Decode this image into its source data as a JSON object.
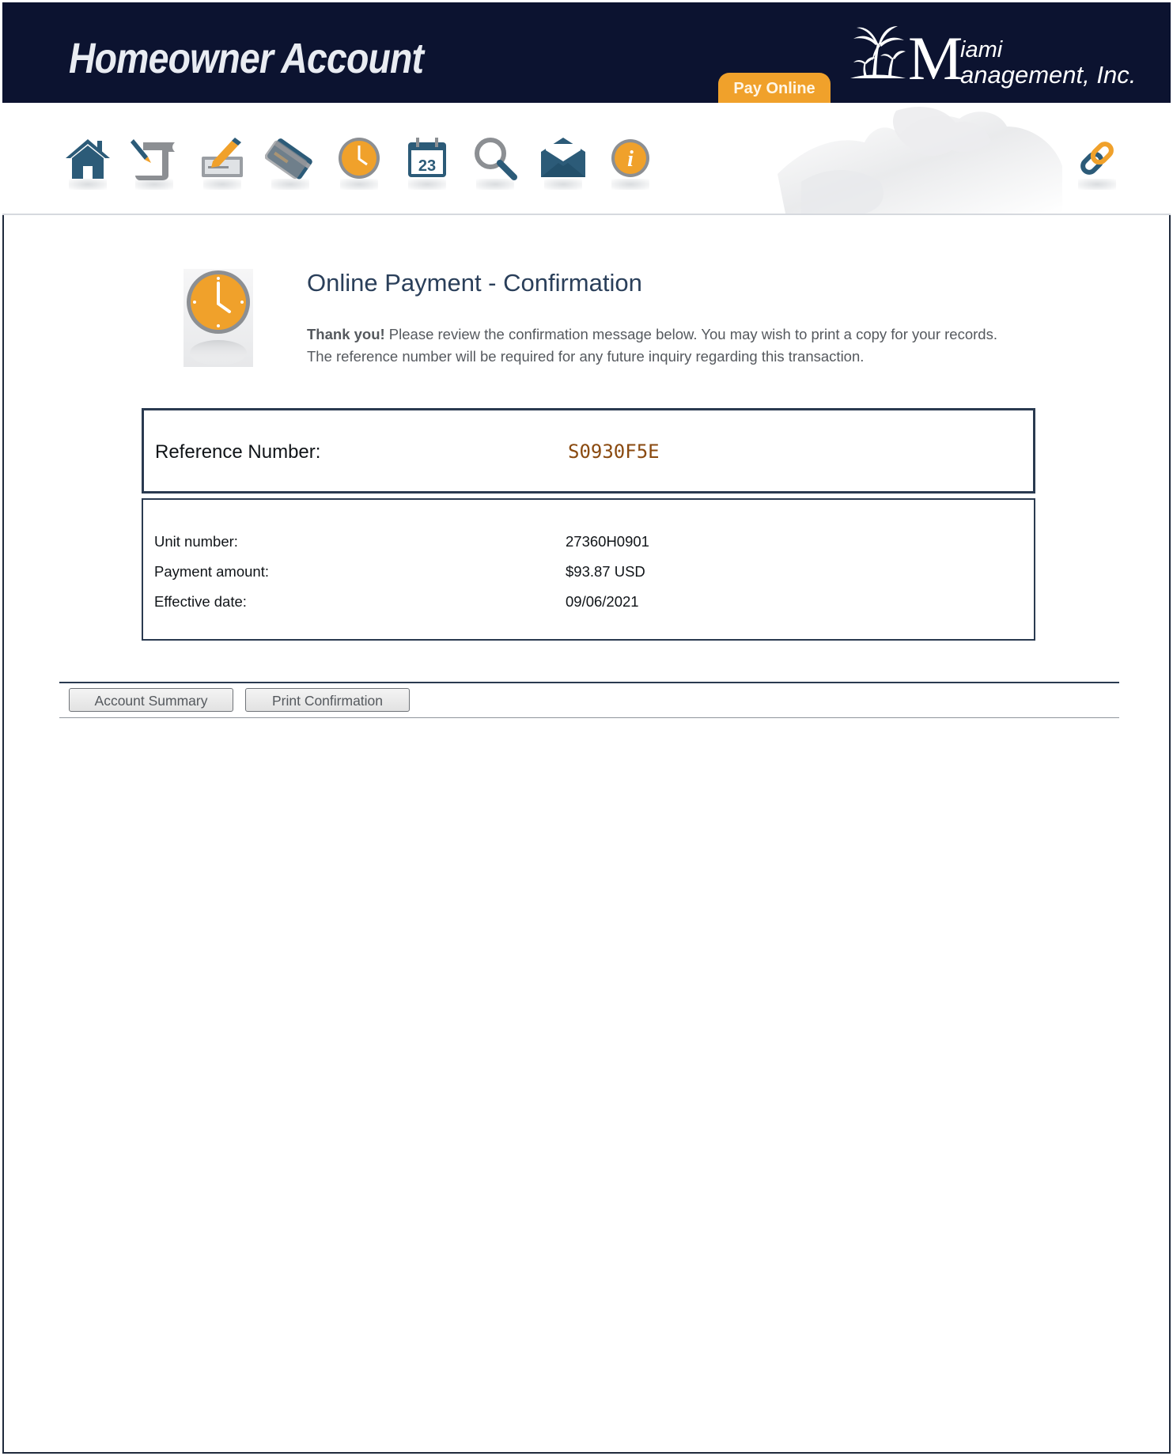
{
  "header": {
    "app_title": "Homeowner Account",
    "pay_online_label": "Pay Online",
    "logo": {
      "initial": "M",
      "line1": "iami",
      "line2": "anagement, Inc."
    }
  },
  "nav_icons": [
    {
      "name": "home-icon"
    },
    {
      "name": "ledger-scroll-icon"
    },
    {
      "name": "check-writing-icon"
    },
    {
      "name": "credit-card-icon"
    },
    {
      "name": "clock-icon"
    },
    {
      "name": "calendar-icon",
      "text": "23"
    },
    {
      "name": "search-icon"
    },
    {
      "name": "mail-icon"
    },
    {
      "name": "info-icon",
      "text": "i"
    },
    {
      "name": "link-icon"
    }
  ],
  "main": {
    "title": "Online Payment - Confirmation",
    "intro_bold": "Thank you!",
    "intro_line1": " Please review the confirmation message below. You may wish to print a copy for your records.",
    "intro_line2": "The reference number will be required for any future inquiry regarding this transaction.",
    "reference": {
      "label": "Reference Number:",
      "value": "S0930F5E"
    },
    "details": [
      {
        "label": "Unit number:",
        "value": "27360H0901"
      },
      {
        "label": "Payment amount:",
        "value": "$93.87 USD"
      },
      {
        "label": "Effective date:",
        "value": "09/06/2021"
      }
    ]
  },
  "actions": {
    "account_summary": "Account Summary",
    "print_confirmation": "Print Confirmation"
  },
  "colors": {
    "header_bg": "#0c1330",
    "accent_orange": "#f0a12b",
    "icon_blue": "#2c5b78",
    "reference_text": "#8a4a10",
    "border": "#2a3a50"
  }
}
